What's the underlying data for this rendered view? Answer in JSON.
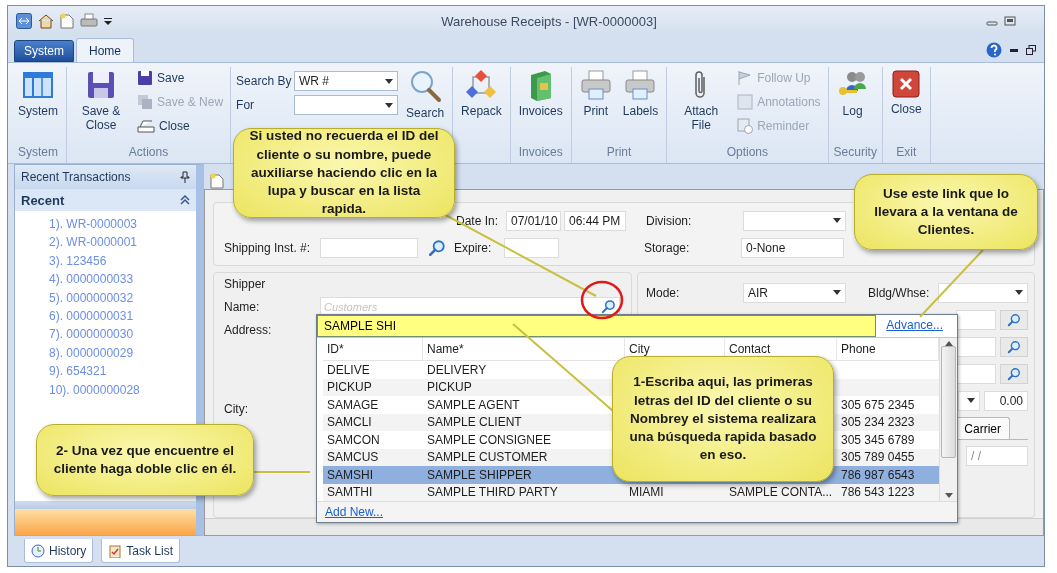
{
  "window": {
    "title": "Warehouse Receipts - [WR-0000003]"
  },
  "app_menu": "System",
  "tabs": [
    {
      "label": "Home",
      "selected": true
    }
  ],
  "ribbon": {
    "groups": [
      {
        "title": "System",
        "items": [
          {
            "kind": "large",
            "label": "System"
          }
        ]
      },
      {
        "title": "Actions",
        "items": [
          {
            "kind": "large",
            "label": "Save & Close"
          },
          {
            "kind": "small",
            "label": "Save",
            "disabled": false
          },
          {
            "kind": "small",
            "label": "Save & New",
            "disabled": true
          },
          {
            "kind": "small",
            "label": "Close",
            "disabled": false
          }
        ]
      },
      {
        "items": [
          {
            "kind": "field",
            "label": "Search By",
            "value": "WR #"
          },
          {
            "kind": "field",
            "label": "For"
          },
          {
            "kind": "large",
            "label": "Search"
          }
        ]
      },
      {
        "items": [
          {
            "kind": "large",
            "label": "Repack"
          }
        ]
      },
      {
        "title": "Invoices",
        "items": [
          {
            "kind": "large",
            "label": "Invoices"
          }
        ]
      },
      {
        "title": "Print",
        "items": [
          {
            "kind": "large",
            "label": "Print"
          },
          {
            "kind": "large",
            "label": "Labels"
          }
        ]
      },
      {
        "title": "Options",
        "items": [
          {
            "kind": "large",
            "label": "Attach File"
          },
          {
            "kind": "small",
            "label": "Follow Up",
            "disabled": true
          },
          {
            "kind": "small",
            "label": "Annotations",
            "disabled": true
          },
          {
            "kind": "small",
            "label": "Reminder",
            "disabled": true
          }
        ]
      },
      {
        "title": "Security",
        "items": [
          {
            "kind": "large",
            "label": "Log"
          }
        ]
      },
      {
        "title": "Exit",
        "items": [
          {
            "kind": "large",
            "label": "Close"
          }
        ]
      }
    ]
  },
  "sidebar": {
    "title": "Recent Transactions",
    "section": {
      "title": "Recent",
      "expanded": true
    },
    "items": [
      "1). WR-0000003",
      "2). WR-0000001",
      "3). 123456",
      "4). 0000000033",
      "5). 0000000032",
      "6). 0000000031",
      "7). 0000000030",
      "8). 0000000029",
      "9). 654321",
      "10). 0000000028"
    ]
  },
  "form": {
    "date_in": {
      "label": "Date In:",
      "date": "07/01/10",
      "time": "06:44 PM"
    },
    "division": {
      "label": "Division:"
    },
    "shipping_inst": {
      "label": "Shipping Inst. #:"
    },
    "expire": {
      "label": "Expire:"
    },
    "storage": {
      "label": "Storage:",
      "value": "0-None"
    },
    "shipper": {
      "title": "Shipper",
      "name_label": "Name:",
      "name_placeholder": "Customers",
      "address_label": "Address:",
      "city_label": "City:"
    },
    "mode": {
      "label": "Mode:",
      "value": "AIR"
    },
    "bldg": {
      "label": "Bldg/Whse:"
    },
    "amount": "0.00",
    "side_tab": "Carrier",
    "date_mask": "/  /"
  },
  "lookup": {
    "query": "SAMPLE SHI",
    "advance_link": "Advance...",
    "columns": [
      "ID*",
      "Name*",
      "City",
      "Contact",
      "Phone"
    ],
    "rows": [
      {
        "id": "DELIVE",
        "name": "DELIVERY",
        "selected": false
      },
      {
        "id": "PICKUP",
        "name": "PICKUP",
        "selected": false
      },
      {
        "id": "SAMAGE",
        "name": "SAMPLE AGENT",
        "phone": "305 675 2345",
        "selected": false
      },
      {
        "id": "SAMCLI",
        "name": "SAMPLE CLIENT",
        "phone": "305 234 2323",
        "selected": false
      },
      {
        "id": "SAMCON",
        "name": "SAMPLE CONSIGNEE",
        "phone": "305 345 6789",
        "selected": false
      },
      {
        "id": "SAMCUS",
        "name": "SAMPLE CUSTOMER",
        "phone": "305 789 0455",
        "selected": false
      },
      {
        "id": "SAMSHI",
        "name": "SAMPLE SHIPPER",
        "phone": "786 987 6543",
        "selected": true
      },
      {
        "id": "SAMTHI",
        "name": "SAMPLE THIRD PARTY",
        "city": "MIAMI",
        "contact": "SAMPLE CONTA...",
        "phone": "786 543 1223",
        "selected": false
      }
    ],
    "add_link": "Add New..."
  },
  "bottom_tabs": [
    "History",
    "Task List"
  ],
  "callouts": [
    {
      "text": "Si usted no recuerda el ID del cliente o su nombre, puede auxiliarse haciendo clic en la lupa y buscar en la lista rapida."
    },
    {
      "text": "Use este link que lo llevara a la ventana de Clientes."
    },
    {
      "text": "1-Escriba aqui, las primeras letras del ID del cliente o su Nombrey el sistema realizara una búsqueda rapida basado en eso."
    },
    {
      "text": "2- Una vez que encuentre el cliente haga doble clic en él."
    }
  ]
}
